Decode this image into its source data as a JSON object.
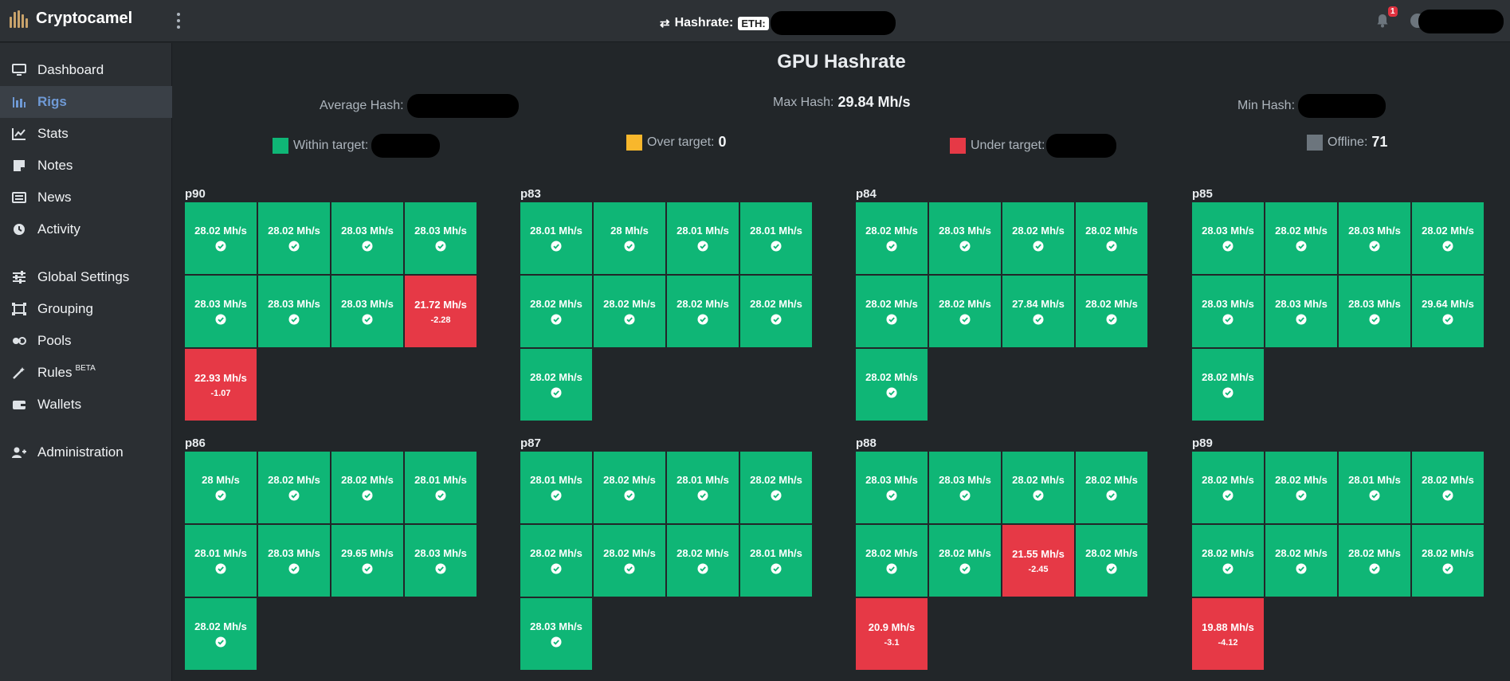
{
  "app": {
    "name": "Cryptocamel"
  },
  "header": {
    "hashrate_label": "Hashrate:",
    "coin_badge": "ETH:",
    "notification_count": "1"
  },
  "sidebar": {
    "items": [
      {
        "label": "Dashboard",
        "icon": "monitor-icon"
      },
      {
        "label": "Rigs",
        "icon": "bar-chart-icon",
        "active": true
      },
      {
        "label": "Stats",
        "icon": "line-chart-icon"
      },
      {
        "label": "Notes",
        "icon": "note-icon"
      },
      {
        "label": "News",
        "icon": "newspaper-icon"
      },
      {
        "label": "Activity",
        "icon": "clock-icon"
      },
      {
        "label": "Global Settings",
        "icon": "sliders-icon"
      },
      {
        "label": "Grouping",
        "icon": "group-icon"
      },
      {
        "label": "Pools",
        "icon": "pool-icon"
      },
      {
        "label": "Rules",
        "icon": "wand-icon",
        "badge": "BETA"
      },
      {
        "label": "Wallets",
        "icon": "wallet-icon"
      },
      {
        "label": "Administration",
        "icon": "user-plus-icon"
      }
    ]
  },
  "page": {
    "title": "GPU Hashrate",
    "average_hash_label": "Average Hash:",
    "max_hash_label": "Max Hash:",
    "max_hash_value": "29.84 Mh/s",
    "min_hash_label": "Min Hash:",
    "legend": {
      "within_label": "Within target:",
      "over_label": "Over target:",
      "over_value": "0",
      "under_label": "Under target:",
      "offline_label": "Offline:",
      "offline_value": "71"
    }
  },
  "colors": {
    "within": "#0fb676",
    "over": "#f8b72c",
    "under": "#e63946",
    "offline": "#6c757d",
    "accent": "#6f9ad6"
  },
  "rigs": [
    {
      "name": "p90",
      "gpus": [
        {
          "rate": "28.02 Mh/s",
          "status": "ok"
        },
        {
          "rate": "28.02 Mh/s",
          "status": "ok"
        },
        {
          "rate": "28.03 Mh/s",
          "status": "ok"
        },
        {
          "rate": "28.03 Mh/s",
          "status": "ok"
        },
        {
          "rate": "28.03 Mh/s",
          "status": "ok"
        },
        {
          "rate": "28.03 Mh/s",
          "status": "ok"
        },
        {
          "rate": "28.03 Mh/s",
          "status": "ok"
        },
        {
          "rate": "21.72 Mh/s",
          "status": "under",
          "diff": "-2.28"
        },
        {
          "rate": "22.93 Mh/s",
          "status": "under",
          "diff": "-1.07"
        }
      ]
    },
    {
      "name": "p83",
      "gpus": [
        {
          "rate": "28.01 Mh/s",
          "status": "ok"
        },
        {
          "rate": "28 Mh/s",
          "status": "ok"
        },
        {
          "rate": "28.01 Mh/s",
          "status": "ok"
        },
        {
          "rate": "28.01 Mh/s",
          "status": "ok"
        },
        {
          "rate": "28.02 Mh/s",
          "status": "ok"
        },
        {
          "rate": "28.02 Mh/s",
          "status": "ok"
        },
        {
          "rate": "28.02 Mh/s",
          "status": "ok"
        },
        {
          "rate": "28.02 Mh/s",
          "status": "ok"
        },
        {
          "rate": "28.02 Mh/s",
          "status": "ok"
        }
      ]
    },
    {
      "name": "p84",
      "gpus": [
        {
          "rate": "28.02 Mh/s",
          "status": "ok"
        },
        {
          "rate": "28.03 Mh/s",
          "status": "ok"
        },
        {
          "rate": "28.02 Mh/s",
          "status": "ok"
        },
        {
          "rate": "28.02 Mh/s",
          "status": "ok"
        },
        {
          "rate": "28.02 Mh/s",
          "status": "ok"
        },
        {
          "rate": "28.02 Mh/s",
          "status": "ok"
        },
        {
          "rate": "27.84 Mh/s",
          "status": "ok"
        },
        {
          "rate": "28.02 Mh/s",
          "status": "ok"
        },
        {
          "rate": "28.02 Mh/s",
          "status": "ok"
        }
      ]
    },
    {
      "name": "p85",
      "gpus": [
        {
          "rate": "28.03 Mh/s",
          "status": "ok"
        },
        {
          "rate": "28.02 Mh/s",
          "status": "ok"
        },
        {
          "rate": "28.03 Mh/s",
          "status": "ok"
        },
        {
          "rate": "28.02 Mh/s",
          "status": "ok"
        },
        {
          "rate": "28.03 Mh/s",
          "status": "ok"
        },
        {
          "rate": "28.03 Mh/s",
          "status": "ok"
        },
        {
          "rate": "28.03 Mh/s",
          "status": "ok"
        },
        {
          "rate": "29.64 Mh/s",
          "status": "ok"
        },
        {
          "rate": "28.02 Mh/s",
          "status": "ok"
        }
      ]
    },
    {
      "name": "p86",
      "gpus": [
        {
          "rate": "28 Mh/s",
          "status": "ok"
        },
        {
          "rate": "28.02 Mh/s",
          "status": "ok"
        },
        {
          "rate": "28.02 Mh/s",
          "status": "ok"
        },
        {
          "rate": "28.01 Mh/s",
          "status": "ok"
        },
        {
          "rate": "28.01 Mh/s",
          "status": "ok"
        },
        {
          "rate": "28.03 Mh/s",
          "status": "ok"
        },
        {
          "rate": "29.65 Mh/s",
          "status": "ok"
        },
        {
          "rate": "28.03 Mh/s",
          "status": "ok"
        },
        {
          "rate": "28.02 Mh/s",
          "status": "ok"
        }
      ]
    },
    {
      "name": "p87",
      "gpus": [
        {
          "rate": "28.01 Mh/s",
          "status": "ok"
        },
        {
          "rate": "28.02 Mh/s",
          "status": "ok"
        },
        {
          "rate": "28.01 Mh/s",
          "status": "ok"
        },
        {
          "rate": "28.02 Mh/s",
          "status": "ok"
        },
        {
          "rate": "28.02 Mh/s",
          "status": "ok"
        },
        {
          "rate": "28.02 Mh/s",
          "status": "ok"
        },
        {
          "rate": "28.02 Mh/s",
          "status": "ok"
        },
        {
          "rate": "28.01 Mh/s",
          "status": "ok"
        },
        {
          "rate": "28.03 Mh/s",
          "status": "ok"
        }
      ]
    },
    {
      "name": "p88",
      "gpus": [
        {
          "rate": "28.03 Mh/s",
          "status": "ok"
        },
        {
          "rate": "28.03 Mh/s",
          "status": "ok"
        },
        {
          "rate": "28.02 Mh/s",
          "status": "ok"
        },
        {
          "rate": "28.02 Mh/s",
          "status": "ok"
        },
        {
          "rate": "28.02 Mh/s",
          "status": "ok"
        },
        {
          "rate": "28.02 Mh/s",
          "status": "ok"
        },
        {
          "rate": "21.55 Mh/s",
          "status": "under",
          "diff": "-2.45"
        },
        {
          "rate": "28.02 Mh/s",
          "status": "ok"
        },
        {
          "rate": "20.9 Mh/s",
          "status": "under",
          "diff": "-3.1"
        }
      ]
    },
    {
      "name": "p89",
      "gpus": [
        {
          "rate": "28.02 Mh/s",
          "status": "ok"
        },
        {
          "rate": "28.02 Mh/s",
          "status": "ok"
        },
        {
          "rate": "28.01 Mh/s",
          "status": "ok"
        },
        {
          "rate": "28.02 Mh/s",
          "status": "ok"
        },
        {
          "rate": "28.02 Mh/s",
          "status": "ok"
        },
        {
          "rate": "28.02 Mh/s",
          "status": "ok"
        },
        {
          "rate": "28.02 Mh/s",
          "status": "ok"
        },
        {
          "rate": "28.02 Mh/s",
          "status": "ok"
        },
        {
          "rate": "19.88 Mh/s",
          "status": "under",
          "diff": "-4.12"
        }
      ]
    }
  ]
}
